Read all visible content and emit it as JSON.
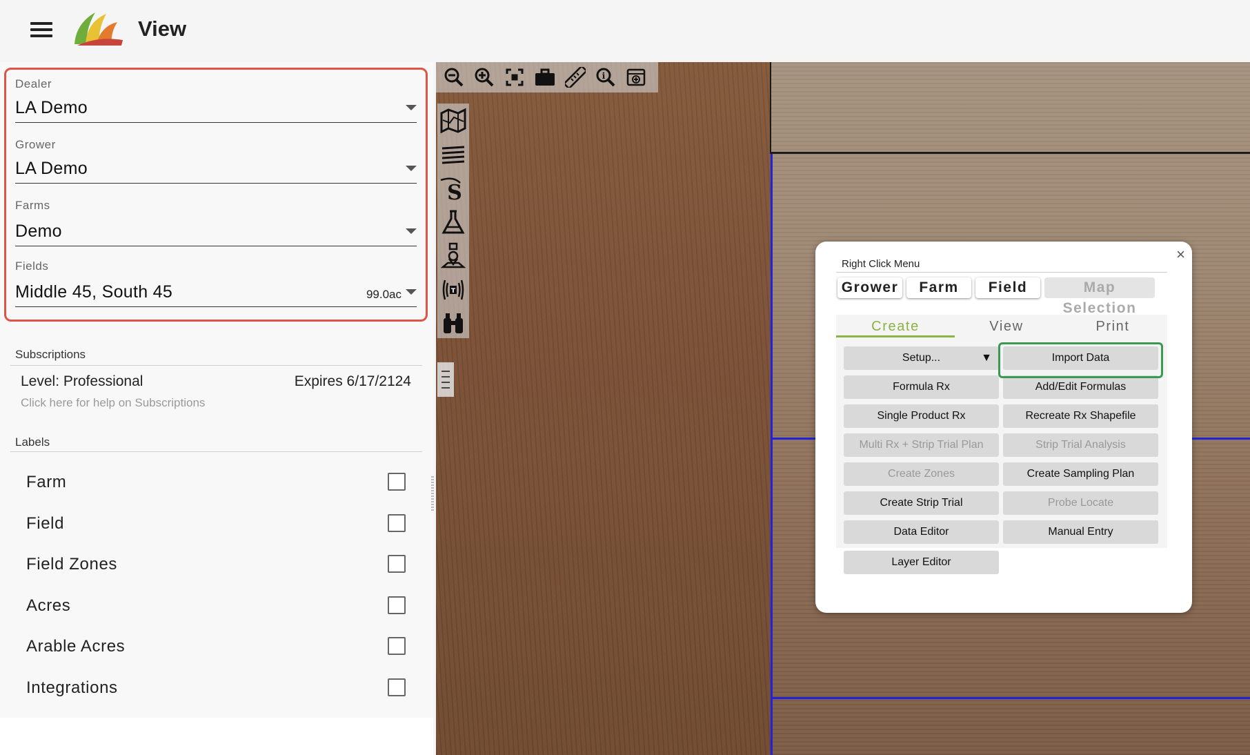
{
  "header": {
    "title": "View",
    "menu_icon": "hamburger-icon",
    "logo_icon": "app-logo"
  },
  "selectors": {
    "dealer": {
      "label": "Dealer",
      "value": "LA Demo"
    },
    "grower": {
      "label": "Grower",
      "value": "LA Demo"
    },
    "farms": {
      "label": "Farms",
      "value": "Demo"
    },
    "fields": {
      "label": "Fields",
      "value": "Middle 45, South 45",
      "acres": "99.0ac"
    }
  },
  "subscriptions": {
    "heading": "Subscriptions",
    "level": "Level: Professional",
    "expires": "Expires 6/17/2124",
    "help": "Click here for help on Subscriptions"
  },
  "labels": {
    "heading": "Labels",
    "items": [
      {
        "label": "Farm",
        "checked": false
      },
      {
        "label": "Field",
        "checked": false
      },
      {
        "label": "Field Zones",
        "checked": false
      },
      {
        "label": "Acres",
        "checked": false
      },
      {
        "label": "Arable Acres",
        "checked": false
      },
      {
        "label": "Integrations",
        "checked": false
      }
    ]
  },
  "map_toolbar": {
    "top_tools": [
      "zoom-out-icon",
      "zoom-in-icon",
      "fit-extent-icon",
      "briefcase-icon",
      "ruler-icon",
      "identify-icon",
      "screenshot-icon"
    ],
    "side_tools": [
      "map-icon",
      "layers-icon",
      "seed-icon",
      "flask-icon",
      "soil-probe-icon",
      "sensor-icon",
      "binoculars-icon"
    ]
  },
  "popup": {
    "title": "Right Click Menu",
    "close_label": "×",
    "context_tabs": [
      {
        "label": "Grower",
        "enabled": true
      },
      {
        "label": "Farm",
        "enabled": true
      },
      {
        "label": "Field",
        "enabled": true
      },
      {
        "label": "Map Selection",
        "enabled": false
      }
    ],
    "mode_tabs": [
      {
        "label": "Create",
        "active": true
      },
      {
        "label": "View",
        "active": false
      },
      {
        "label": "Print",
        "active": false
      }
    ],
    "setup": {
      "label": "Setup...",
      "caret": "▼"
    },
    "actions_left": [
      {
        "label": "Formula Rx",
        "enabled": true
      },
      {
        "label": "Single Product Rx",
        "enabled": true
      },
      {
        "label": "Multi Rx + Strip Trial Plan",
        "enabled": false
      },
      {
        "label": "Create Zones",
        "enabled": false
      },
      {
        "label": "Create Strip Trial",
        "enabled": true
      },
      {
        "label": "Data Editor",
        "enabled": true
      },
      {
        "label": "Layer Editor",
        "enabled": true
      }
    ],
    "actions_right": [
      {
        "label": "Import Data",
        "enabled": true,
        "highlighted": true
      },
      {
        "label": "Add/Edit Formulas",
        "enabled": true
      },
      {
        "label": "Recreate Rx Shapefile",
        "enabled": true
      },
      {
        "label": "Strip Trial Analysis",
        "enabled": false
      },
      {
        "label": "Create Sampling Plan",
        "enabled": true
      },
      {
        "label": "Probe Locate",
        "enabled": false
      },
      {
        "label": "Manual Entry",
        "enabled": true
      }
    ]
  },
  "colors": {
    "selector_highlight": "#e05445",
    "action_highlight": "#3a9a54",
    "active_tab": "#8bb244",
    "field_boundary": "#2222dd"
  }
}
